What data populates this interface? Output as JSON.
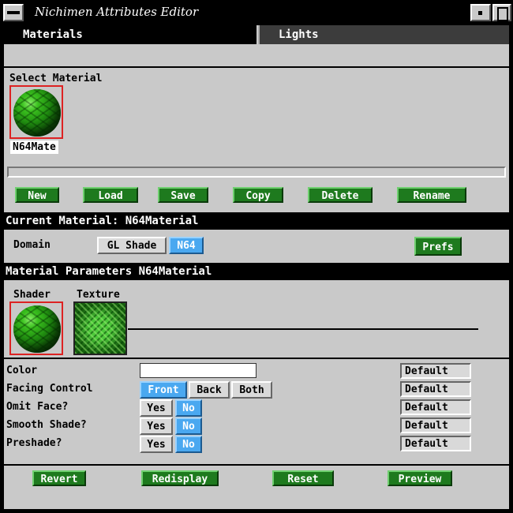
{
  "window": {
    "title": "Nichimen Attributes Editor"
  },
  "tabs": [
    {
      "label": "Materials",
      "active": true
    },
    {
      "label": "Lights",
      "active": false
    }
  ],
  "select_material": {
    "label": "Select Material",
    "items": [
      {
        "name": "N64Mate",
        "selected": true
      }
    ]
  },
  "actions": [
    "New",
    "Load",
    "Save",
    "Copy",
    "Delete",
    "Rename"
  ],
  "current_material": {
    "bar": "Current Material: N64Material"
  },
  "domain": {
    "label": "Domain",
    "options": [
      {
        "label": "GL Shade",
        "selected": false
      },
      {
        "label": "N64",
        "selected": true
      }
    ],
    "prefs_label": "Prefs"
  },
  "params": {
    "bar": "Material Parameters N64Material",
    "shader_label": "Shader",
    "texture_label": "Texture",
    "rows": [
      {
        "label": "Color",
        "type": "color",
        "value": "#ffffff",
        "default": "Default"
      },
      {
        "label": "Facing Control",
        "type": "choice",
        "options": [
          {
            "label": "Front",
            "selected": true
          },
          {
            "label": "Back",
            "selected": false
          },
          {
            "label": "Both",
            "selected": false
          }
        ],
        "default": "Default"
      },
      {
        "label": "Omit Face?",
        "type": "choice",
        "options": [
          {
            "label": "Yes",
            "selected": false
          },
          {
            "label": "No",
            "selected": true
          }
        ],
        "default": "Default"
      },
      {
        "label": "Smooth Shade?",
        "type": "choice",
        "options": [
          {
            "label": "Yes",
            "selected": false
          },
          {
            "label": "No",
            "selected": true
          }
        ],
        "default": "Default"
      },
      {
        "label": "Preshade?",
        "type": "choice",
        "options": [
          {
            "label": "Yes",
            "selected": false
          },
          {
            "label": "No",
            "selected": true
          }
        ],
        "default": "Default"
      }
    ]
  },
  "footer": [
    "Revert",
    "Redisplay",
    "Reset",
    "Preview"
  ],
  "colors": {
    "accent_green": "#1e7a1e",
    "selected_blue": "#4aa8f0",
    "selection_red": "#dd2222",
    "panel_gray": "#c9c9c9"
  },
  "icons": [
    "window-menu-icon",
    "minimize-icon",
    "maximize-icon",
    "material-sphere-icon",
    "texture-swatch-icon"
  ]
}
